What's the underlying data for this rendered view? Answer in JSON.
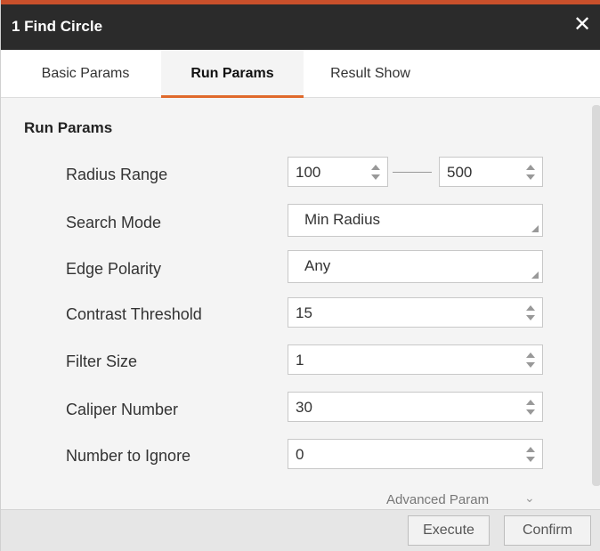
{
  "window": {
    "title": "1 Find Circle",
    "close_icon": "close-icon"
  },
  "tabs": [
    {
      "label": "Basic Params",
      "active": false
    },
    {
      "label": "Run Params",
      "active": true
    },
    {
      "label": "Result Show",
      "active": false
    }
  ],
  "section": {
    "title": "Run Params"
  },
  "params": {
    "radius_range": {
      "label": "Radius Range",
      "min": "100",
      "max": "500"
    },
    "search_mode": {
      "label": "Search Mode",
      "value": "Min Radius"
    },
    "edge_polarity": {
      "label": "Edge Polarity",
      "value": "Any"
    },
    "contrast_threshold": {
      "label": "Contrast Threshold",
      "value": "15"
    },
    "filter_size": {
      "label": "Filter Size",
      "value": "1"
    },
    "caliper_number": {
      "label": "Caliper Number",
      "value": "30"
    },
    "number_to_ignore": {
      "label": "Number to Ignore",
      "value": "0"
    }
  },
  "advanced": {
    "label": "Advanced Param",
    "icon": "chevron-down-icon"
  },
  "footer": {
    "execute_label": "Execute",
    "confirm_label": "Confirm"
  },
  "colors": {
    "title_bar": "#2b2b2b",
    "accent": "#e06a2c",
    "panel": "#f4f4f4"
  }
}
